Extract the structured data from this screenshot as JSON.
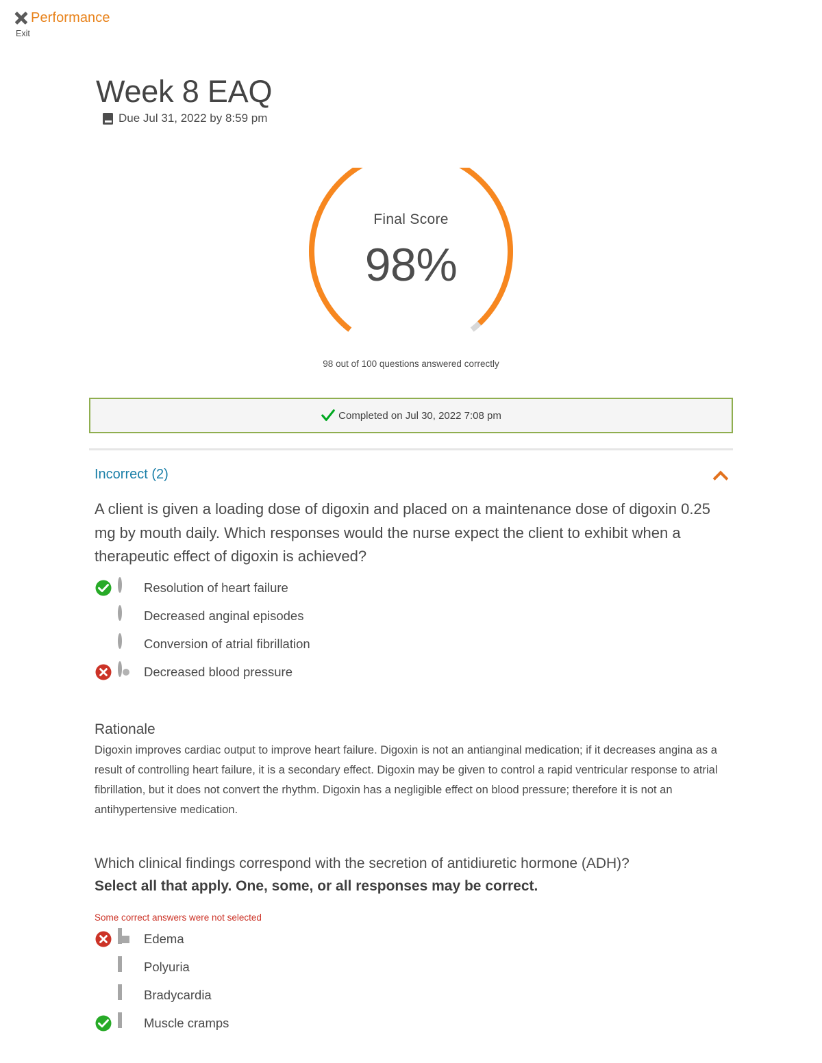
{
  "topbar": {
    "close_icon": "close-x-icon",
    "brand": "Performance",
    "exit_label": "Exit"
  },
  "assignment": {
    "title": "Week 8 EAQ",
    "due_icon": "book-icon",
    "due_text": "Due Jul 31, 2022 by 8:59 pm"
  },
  "gauge": {
    "label": "Final Score",
    "value": "98%",
    "caption": "98 out of 100 questions answered correctly",
    "percent": 98,
    "arc_color": "#f7871f",
    "track_color": "#d8d8d8"
  },
  "banner": {
    "check_icon": "green-check-icon",
    "text": "Completed on Jul 30, 2022 7:08 pm",
    "border_color": "#8fae4f",
    "background": "#f5f5f5"
  },
  "section": {
    "title": "Incorrect (2)",
    "collapse_icon": "chevron-up-icon",
    "title_color": "#1a7fa8",
    "icon_color": "#e2711d"
  },
  "questions": [
    {
      "prompt": "A client is given a loading dose of digoxin and placed on a maintenance dose of digoxin 0.25 mg by mouth daily. Which responses would the nurse expect the client to exhibit when a therapeutic effect of digoxin is achieved?",
      "instruction": "",
      "note": "",
      "input_type": "radio",
      "options": [
        {
          "label": "Resolution of heart failure",
          "marker": "correct",
          "selected": false
        },
        {
          "label": "Decreased anginal episodes",
          "marker": "none",
          "selected": false
        },
        {
          "label": "Conversion of atrial fibrillation",
          "marker": "none",
          "selected": false
        },
        {
          "label": "Decreased blood pressure",
          "marker": "incorrect",
          "selected": true
        }
      ],
      "rationale_title": "Rationale",
      "rationale": "Digoxin improves cardiac output to improve heart failure. Digoxin is not an antianginal medication; if it decreases angina as a result of controlling heart failure, it is a secondary effect. Digoxin may be given to control a rapid ventricular response to atrial fibrillation, but it does not convert the rhythm. Digoxin has a negligible effect on blood pressure; therefore it is not an antihypertensive medication."
    },
    {
      "prompt": "Which clinical findings correspond with the secretion of antidiuretic hormone (ADH)?",
      "instruction": "Select all that apply. One, some, or all responses may be correct.",
      "note": "Some correct answers were not selected",
      "input_type": "checkbox",
      "options": [
        {
          "label": "Edema",
          "marker": "incorrect",
          "selected": true
        },
        {
          "label": "Polyuria",
          "marker": "none",
          "selected": false
        },
        {
          "label": "Bradycardia",
          "marker": "none",
          "selected": false
        },
        {
          "label": "Muscle cramps",
          "marker": "correct",
          "selected": false
        }
      ],
      "rationale_title": "",
      "rationale": ""
    }
  ],
  "colors": {
    "correct_green": "#27aa27",
    "incorrect_red": "#cc3327",
    "banner_check_green": "#00a820",
    "orange": "#e8821a"
  }
}
